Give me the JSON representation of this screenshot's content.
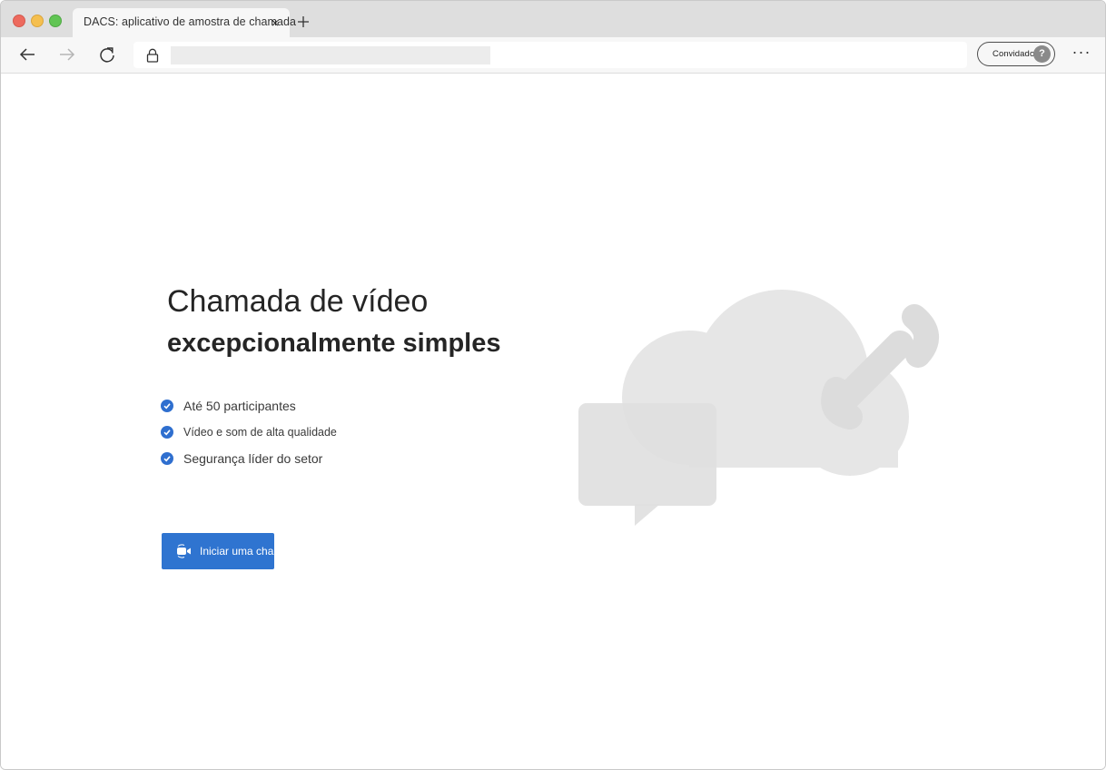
{
  "browser": {
    "tab_title": "DACS: aplicativo de amostra de chamada",
    "tab_close": "×",
    "profile_label": "Convidado",
    "avatar_glyph": "?",
    "more_glyph": "···"
  },
  "main": {
    "title": "Chamada de vídeo",
    "subtitle": "excepcionalmente simples",
    "features": [
      {
        "label": "Até 50 participantes"
      },
      {
        "label": "Vídeo e som de alta qualidade"
      },
      {
        "label": "Segurança líder do setor"
      }
    ],
    "start_button_label": "Iniciar uma chamada"
  },
  "icons": {
    "check": "checkmark-circle-icon",
    "camera": "video-camera-icon",
    "back": "arrow-left-icon",
    "forward": "arrow-right-icon",
    "reload": "reload-icon",
    "lock": "lock-icon"
  },
  "colors": {
    "accent": "#2f74d0",
    "check": "#2f6fcf",
    "illustration_gray": "#e6e6e6"
  }
}
